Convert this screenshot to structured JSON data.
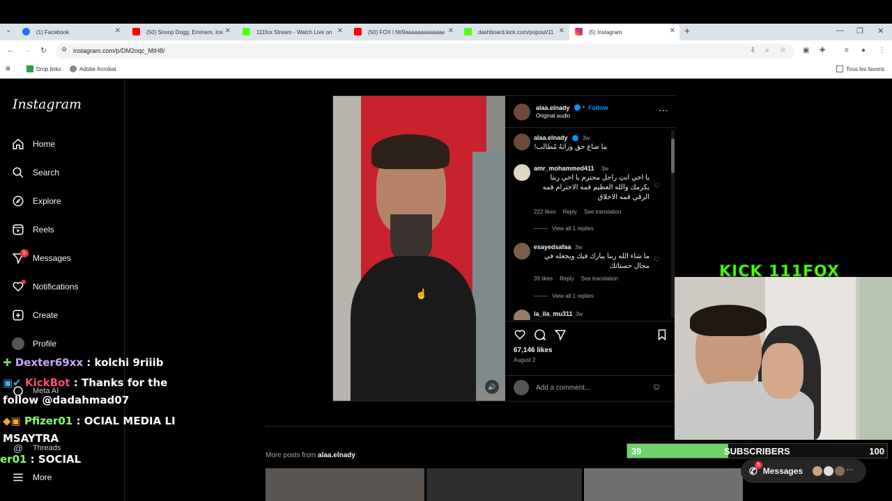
{
  "browser": {
    "tabs": [
      {
        "label": "(1) Facebook",
        "color": "#1877f2"
      },
      {
        "label": "(50) Snoop Dogg, Eminem, Ice",
        "color": "#ff0000"
      },
      {
        "label": "111fox Stream - Watch Live on",
        "color": "#53fc18"
      },
      {
        "label": "(50) FOX l Nti9aaaaaaaaaaaaaa",
        "color": "#ff0000"
      },
      {
        "label": "dashboard.kick.com/popout/11",
        "color": "#53fc18"
      },
      {
        "label": "(5) Instagram",
        "color": "#e1306c"
      }
    ],
    "new_tab": "+",
    "url": "instagram.com/p/DM2oqc_MtH8/",
    "bookmarks": [
      {
        "label": "Drop links"
      },
      {
        "label": "Adobe Acrobat"
      }
    ],
    "favorites": "Tous les favoris"
  },
  "instagram": {
    "logo": "Instagram",
    "nav": [
      {
        "label": "Home",
        "icon": "home-icon"
      },
      {
        "label": "Search",
        "icon": "search-icon"
      },
      {
        "label": "Explore",
        "icon": "explore-icon"
      },
      {
        "label": "Reels",
        "icon": "reels-icon"
      },
      {
        "label": "Messages",
        "icon": "messages-icon",
        "badge": "5"
      },
      {
        "label": "Notifications",
        "icon": "heart-icon"
      },
      {
        "label": "Create",
        "icon": "create-icon"
      },
      {
        "label": "Profile",
        "icon": "profile-avatar"
      },
      {
        "label": "Meta AI",
        "icon": "meta-ai-icon"
      },
      {
        "label": "Threads",
        "icon": "threads-icon"
      },
      {
        "label": "More",
        "icon": "menu-icon"
      }
    ]
  },
  "post": {
    "author": "alaa.elnady",
    "follow": "Follow",
    "dot": "•",
    "audio": "Original audio",
    "caption": {
      "user": "alaa.elnady",
      "time": "3w",
      "text": "ما ضاع حق ورائهُ مُطالب!"
    },
    "comments": [
      {
        "user": "amr_mohammed411",
        "time": "3w",
        "text": "يا اخي انتِ راجل محترم يا اخي ربنا يكرمك والله العظيم قمه الاحترام قمه الرقي قمه الاخلاق",
        "likes": "222 likes",
        "reply": "Reply",
        "translate": "See translation",
        "view_replies": "View all 1 replies"
      },
      {
        "user": "esayedsafaa",
        "time": "3w",
        "text": "ما شاء الله ربنا يبارك فيك ويجعله في مجال حسناتك",
        "likes": "39 likes",
        "reply": "Reply",
        "translate": "See translation",
        "view_replies": "View all 1 replies"
      },
      {
        "user": "la_ila_mu311",
        "time": "3w"
      }
    ],
    "likes": "67,146 likes",
    "date": "August 2",
    "add_comment_placeholder": "Add a comment...",
    "more_posts_prefix": "More posts from",
    "more_posts_user": "alaa.elnady"
  },
  "stream_overlay": {
    "chat": [
      {
        "user": "Dexter69xx",
        "sep": " : ",
        "text": "kolchi 9riiib",
        "color": "#c9a8ff"
      },
      {
        "user": "KickBot",
        "sep": " : ",
        "text": "Thanks for the",
        "text2": "follow @dadahmad07",
        "color": "#ff4d6d"
      },
      {
        "user": "Pfizer01",
        "sep": " : ",
        "text": "OCIAL MEDIA LI",
        "text2": "MSAYTRA",
        "color": "#8aff6b"
      },
      {
        "user": "er01",
        "sep": " : ",
        "text": "SOCIAL",
        "color": "#8aff6b"
      }
    ],
    "kick_logo": "KICK 111FOX",
    "sub_current": "39",
    "sub_label": "SUBSCRIBERS",
    "sub_goal": "100",
    "sub_progress": 0.39,
    "messages_label": "Messages",
    "messages_badge": "5"
  }
}
